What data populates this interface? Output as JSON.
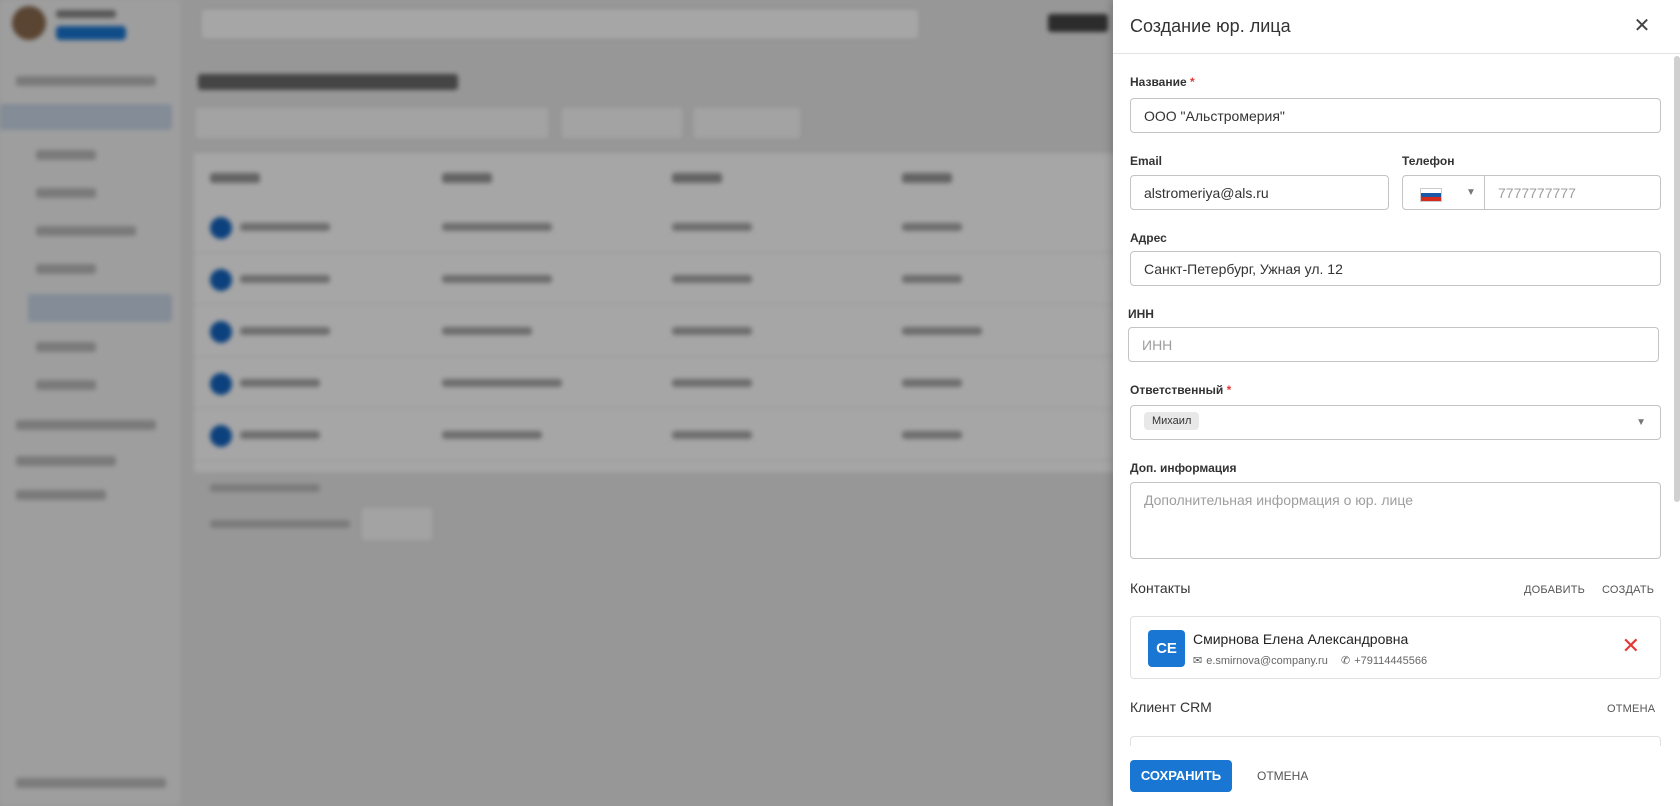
{
  "drawer": {
    "title": "Создание юр. лица",
    "close_icon": "close-icon"
  },
  "form": {
    "name": {
      "label": "Название",
      "required_mark": "*",
      "value": "ООО \"Альстромерия\""
    },
    "email": {
      "label": "Email",
      "value": "alstromeriya@als.ru"
    },
    "phone": {
      "label": "Телефон",
      "country": "Russia",
      "placeholder": "7777777777"
    },
    "address": {
      "label": "Адрес",
      "value": "Санкт-Петербург, Ужная ул. 12"
    },
    "inn": {
      "label": "ИНН",
      "placeholder": "ИНН"
    },
    "responsible": {
      "label": "Ответственный",
      "required_mark": "*",
      "chip": "Михаил"
    },
    "extra_info": {
      "label": "Доп. информация",
      "placeholder": "Дополнительная информация о юр. лице"
    }
  },
  "contacts": {
    "title": "Контакты",
    "add_label": "ДОБАВИТЬ",
    "create_label": "СОЗДАТЬ",
    "items": [
      {
        "initials": "СЕ",
        "name": "Смирнова Елена Александровна",
        "email": "e.smirnova@company.ru",
        "phone": "+79114445566"
      }
    ]
  },
  "crm_client": {
    "title": "Клиент CRM",
    "cancel_label": "ОТМЕНА"
  },
  "footer": {
    "save_label": "СОХРАНИТЬ",
    "cancel_label": "ОТМЕНА"
  },
  "colors": {
    "accent": "#1976d2",
    "danger": "#e53935",
    "overlay": "rgba(0,0,0,0.35)"
  }
}
